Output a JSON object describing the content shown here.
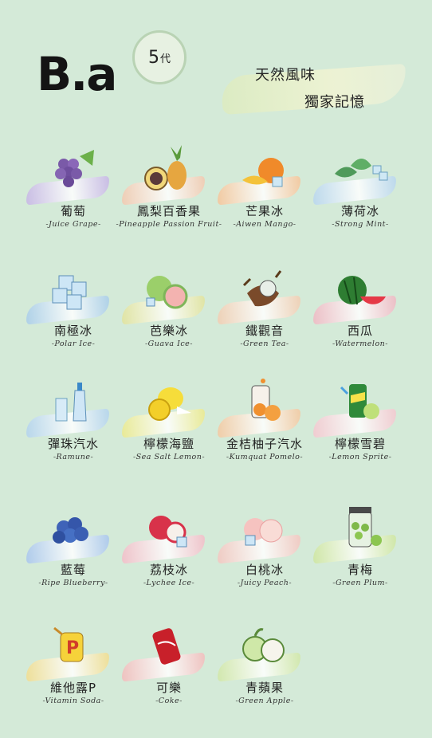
{
  "brand": {
    "name": "B.a",
    "generation_number": "5",
    "generation_suffix": "代"
  },
  "tagline": {
    "line1": "天然風味",
    "line2": "獨家記憶"
  },
  "flavors": [
    {
      "cn": "葡萄",
      "en": "-Juice Grape-",
      "icon": "grape-icon",
      "color": "#c7b6e6"
    },
    {
      "cn": "鳳梨百香果",
      "en": "-Pineapple Passion Fruit-",
      "icon": "pineapple-passionfruit-icon",
      "color": "#f3c9b0"
    },
    {
      "cn": "芒果冰",
      "en": "-Aiwen Mango-",
      "icon": "mango-icon",
      "color": "#f6c59a"
    },
    {
      "cn": "薄荷冰",
      "en": "-Strong Mint-",
      "icon": "mint-icon",
      "color": "#b9d6ef"
    },
    {
      "cn": "南極冰",
      "en": "-Polar Ice-",
      "icon": "ice-cube-icon",
      "color": "#a9cdea"
    },
    {
      "cn": "芭樂冰",
      "en": "-Guava Ice-",
      "icon": "guava-icon",
      "color": "#e2e39c"
    },
    {
      "cn": "鐵觀音",
      "en": "-Green Tea-",
      "icon": "tea-icon",
      "color": "#f2cdb2"
    },
    {
      "cn": "西瓜",
      "en": "-Watermelon-",
      "icon": "watermelon-icon",
      "color": "#f0b8c3"
    },
    {
      "cn": "彈珠汽水",
      "en": "-Ramune-",
      "icon": "ramune-icon",
      "color": "#b3d3ee"
    },
    {
      "cn": "檸檬海鹽",
      "en": "-Sea Salt Lemon-",
      "icon": "lemon-icon",
      "color": "#ecea8d"
    },
    {
      "cn": "金桔柚子汽水",
      "en": "-Kumquat Pomelo-",
      "icon": "kumquat-can-icon",
      "color": "#f4c8a0"
    },
    {
      "cn": "檸檬雪碧",
      "en": "-Lemon Sprite-",
      "icon": "sprite-can-icon",
      "color": "#f4c7cf"
    },
    {
      "cn": "藍莓",
      "en": "-Ripe Blueberry-",
      "icon": "blueberry-icon",
      "color": "#a9c6ee"
    },
    {
      "cn": "荔枝冰",
      "en": "-Lychee Ice-",
      "icon": "lychee-icon",
      "color": "#f3bdc8"
    },
    {
      "cn": "白桃冰",
      "en": "-Juicy Peach-",
      "icon": "peach-icon",
      "color": "#f4c6c0"
    },
    {
      "cn": "青梅",
      "en": "-Green Plum-",
      "icon": "green-plum-jar-icon",
      "color": "#cfe6a0"
    },
    {
      "cn": "維他露P",
      "en": "-Vitamin Soda-",
      "icon": "vitamin-soda-icon",
      "color": "#f2dd8f"
    },
    {
      "cn": "可樂",
      "en": "-Coke-",
      "icon": "cola-can-icon",
      "color": "#f3bcbc"
    },
    {
      "cn": "青蘋果",
      "en": "-Green Apple-",
      "icon": "green-apple-icon",
      "color": "#d1e7a7"
    }
  ]
}
